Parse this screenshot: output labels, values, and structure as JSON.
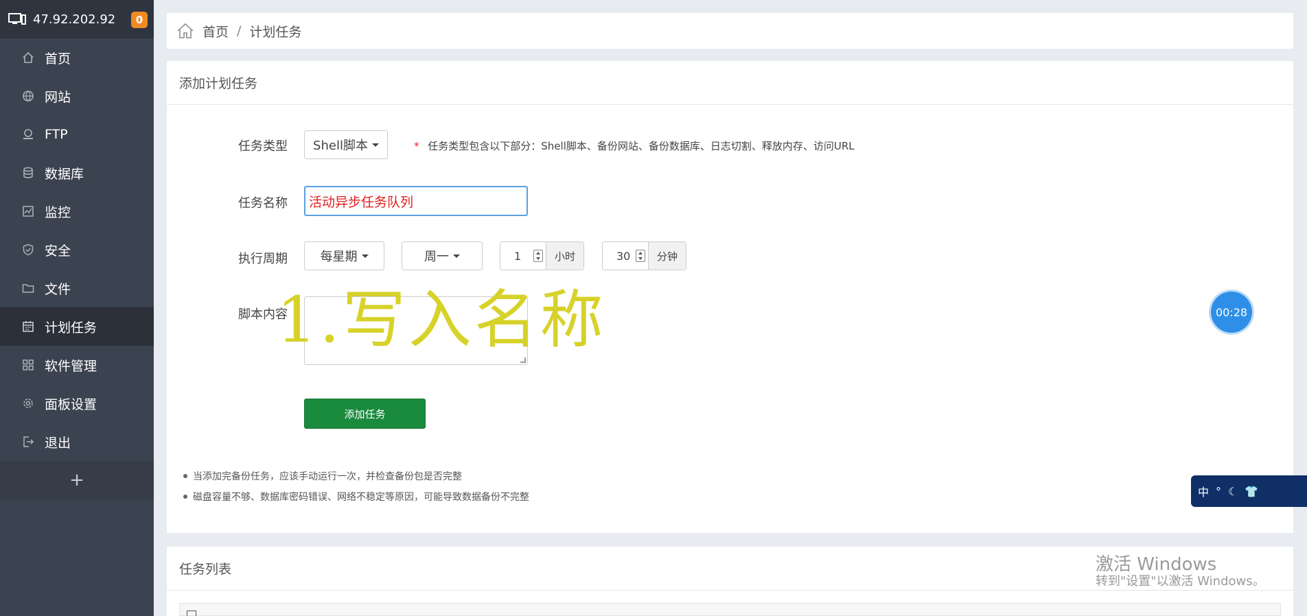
{
  "sidebar": {
    "server_ip": "47.92.202.92",
    "notification_count": "0",
    "items": [
      {
        "label": "首页",
        "icon": "home-icon"
      },
      {
        "label": "网站",
        "icon": "globe-icon"
      },
      {
        "label": "FTP",
        "icon": "ftp-icon"
      },
      {
        "label": "数据库",
        "icon": "database-icon"
      },
      {
        "label": "监控",
        "icon": "monitor-icon"
      },
      {
        "label": "安全",
        "icon": "shield-icon"
      },
      {
        "label": "文件",
        "icon": "folder-icon"
      },
      {
        "label": "计划任务",
        "icon": "calendar-icon"
      },
      {
        "label": "软件管理",
        "icon": "grid-icon"
      },
      {
        "label": "面板设置",
        "icon": "gear-icon"
      },
      {
        "label": "退出",
        "icon": "logout-icon"
      }
    ],
    "active_item": "计划任务",
    "add_label": "+"
  },
  "breadcrumb": {
    "home": "首页",
    "separator": "/",
    "current": "计划任务"
  },
  "form": {
    "title": "添加计划任务",
    "task_type_label": "任务类型",
    "task_type_value": "Shell脚本",
    "task_type_hint_star": "*",
    "task_type_hint": "任务类型包含以下部分：Shell脚本、备份网站、备份数据库、日志切割、释放内存、访问URL",
    "task_name_label": "任务名称",
    "task_name_value": "活动异步任务队列",
    "period_label": "执行周期",
    "period_value": "每星期",
    "weekday_value": "周一",
    "hour_value": "1",
    "hour_unit": "小时",
    "minute_value": "30",
    "minute_unit": "分钟",
    "script_label": "脚本内容",
    "submit_label": "添加任务",
    "tips": [
      "当添加完备份任务，应该手动运行一次，并检查备份包是否完整",
      "磁盘容量不够、数据库密码错误、网络不稳定等原因，可能导致数据备份不完整"
    ]
  },
  "overlay_text": "1.写入名称",
  "task_list": {
    "title": "任务列表"
  },
  "timer": "00:28",
  "ime": {
    "mode": "中",
    "icons": [
      "punctuation-icon",
      "moon-icon",
      "shirt-icon"
    ]
  },
  "watermark": {
    "line1": "激活 Windows",
    "line2": "转到\"设置\"以激活 Windows。"
  }
}
